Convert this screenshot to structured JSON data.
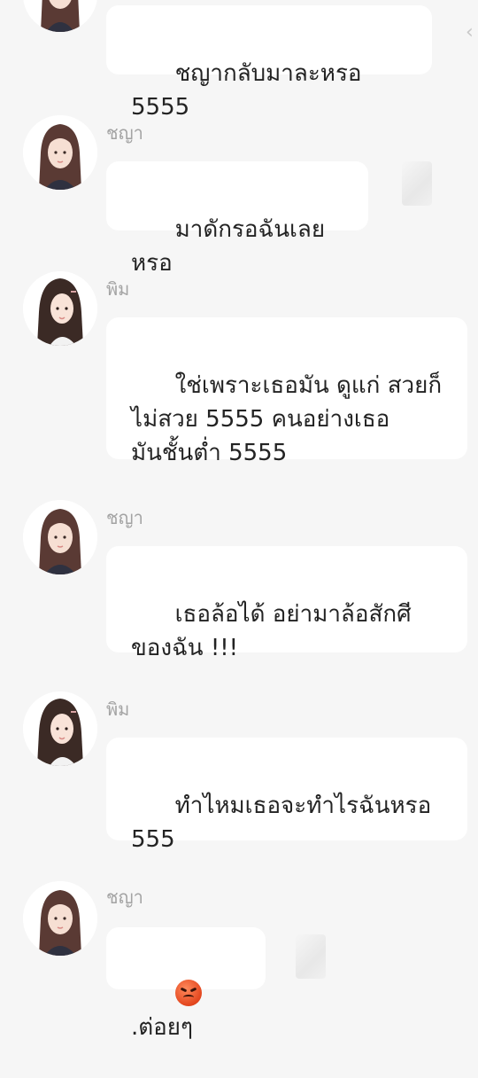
{
  "messages": [
    {
      "sender": "",
      "text": "ชญากลับมาละหรอ 5555"
    },
    {
      "sender": "ชญา",
      "text": "มาดักรอฉันเลยหรอ"
    },
    {
      "sender": "พิม",
      "text": "ใช่เพราะเธอมัน ดูแก่ สวยก็\nไม่สวย 5555 คนอย่างเธอ\nมันชั้นต่ำ 5555"
    },
    {
      "sender": "ชญา",
      "text": "เธอล้อได้ อย่ามาล้อสักศี\nของฉัน !!!"
    },
    {
      "sender": "พิม",
      "text": "ทำไหมเธอจะทำไรฉันหรอ\n555"
    },
    {
      "sender": "ชญา",
      "text": ".ต่อยๆ",
      "emoji": "angry-face-icon"
    }
  ],
  "colors": {
    "background": "#f6f6f6",
    "bubble": "#ffffff",
    "text": "#232323",
    "sender": "#a3a3a3",
    "chaya_hair": "#5a3a34",
    "pim_hair": "#3b2a25"
  }
}
